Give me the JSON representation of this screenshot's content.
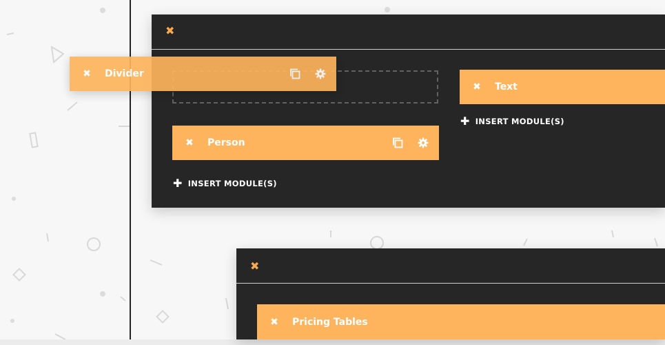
{
  "colors": {
    "section_bg": "#262626",
    "module_bg": "#fdb45c",
    "accent": "#f9a94f",
    "page_bg": "#f7f7f7"
  },
  "icons": {
    "close": "close-icon",
    "duplicate": "duplicate-icon",
    "settings": "gear-icon",
    "add": "plus-icon"
  },
  "dragging_module": {
    "label": "Divider"
  },
  "section1": {
    "column1": {
      "modules": [
        {
          "label": "Person"
        }
      ],
      "insert_label": "INSERT MODULE(S)"
    },
    "column2": {
      "modules": [
        {
          "label": "Text"
        }
      ],
      "insert_label": "INSERT MODULE(S)"
    }
  },
  "section2": {
    "column1": {
      "modules": [
        {
          "label": "Pricing Tables"
        }
      ]
    }
  }
}
